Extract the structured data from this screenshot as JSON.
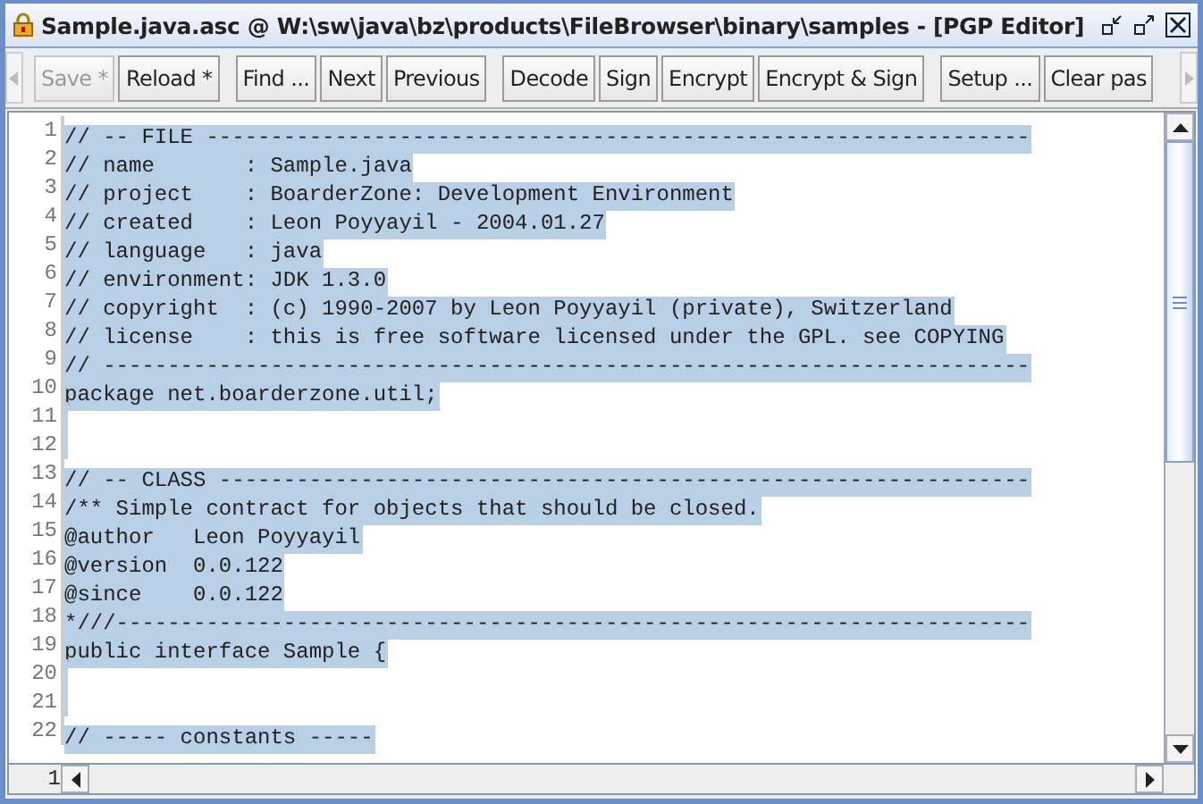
{
  "window": {
    "title": "Sample.java.asc @ W:\\sw\\java\\bz\\products\\FileBrowser\\binary\\samples - [PGP Editor]"
  },
  "toolbar": {
    "groups": [
      [
        {
          "label": "Save *",
          "disabled": true
        },
        {
          "label": "Reload *",
          "disabled": false
        }
      ],
      [
        {
          "label": "Find ...",
          "disabled": false
        },
        {
          "label": "Next",
          "disabled": false
        },
        {
          "label": "Previous",
          "disabled": false
        }
      ],
      [
        {
          "label": "Decode",
          "disabled": false
        },
        {
          "label": "Sign",
          "disabled": false
        },
        {
          "label": "Encrypt",
          "disabled": false
        },
        {
          "label": "Encrypt & Sign",
          "disabled": false
        }
      ],
      [
        {
          "label": "Setup ...",
          "disabled": false
        },
        {
          "label": "Clear pas",
          "disabled": false
        }
      ]
    ]
  },
  "editor": {
    "all_selected": true,
    "lines": [
      {
        "number": "1",
        "text": "// -- FILE ----------------------------------------------------------------"
      },
      {
        "number": "2",
        "text": "// name       : Sample.java"
      },
      {
        "number": "3",
        "text": "// project    : BoarderZone: Development Environment"
      },
      {
        "number": "4",
        "text": "// created    : Leon Poyyayil - 2004.01.27"
      },
      {
        "number": "5",
        "text": "// language   : java"
      },
      {
        "number": "6",
        "text": "// environment: JDK 1.3.0"
      },
      {
        "number": "7",
        "text": "// copyright  : (c) 1990-2007 by Leon Poyyayil (private), Switzerland"
      },
      {
        "number": "8",
        "text": "// license    : this is free software licensed under the GPL. see COPYING"
      },
      {
        "number": "9",
        "text": "// ------------------------------------------------------------------------"
      },
      {
        "number": "10",
        "text": "package net.boarderzone.util;"
      },
      {
        "number": "11"
      },
      {
        "number": "12"
      },
      {
        "number": "13",
        "text": "// -- CLASS ---------------------------------------------------------------"
      },
      {
        "number": "14",
        "text": "/** Simple contract for objects that should be closed."
      },
      {
        "number": "15",
        "text": "@author   Leon Poyyayil"
      },
      {
        "number": "16",
        "text": "@version  0.0.122"
      },
      {
        "number": "17",
        "text": "@since    0.0.122"
      },
      {
        "number": "18",
        "text": "*///-----------------------------------------------------------------------"
      },
      {
        "number": "19",
        "text": "public interface Sample {"
      },
      {
        "number": "20"
      },
      {
        "number": "21"
      },
      {
        "number": "22",
        "text": "// ----- constants -----"
      }
    ]
  },
  "status": {
    "column": "1"
  }
}
